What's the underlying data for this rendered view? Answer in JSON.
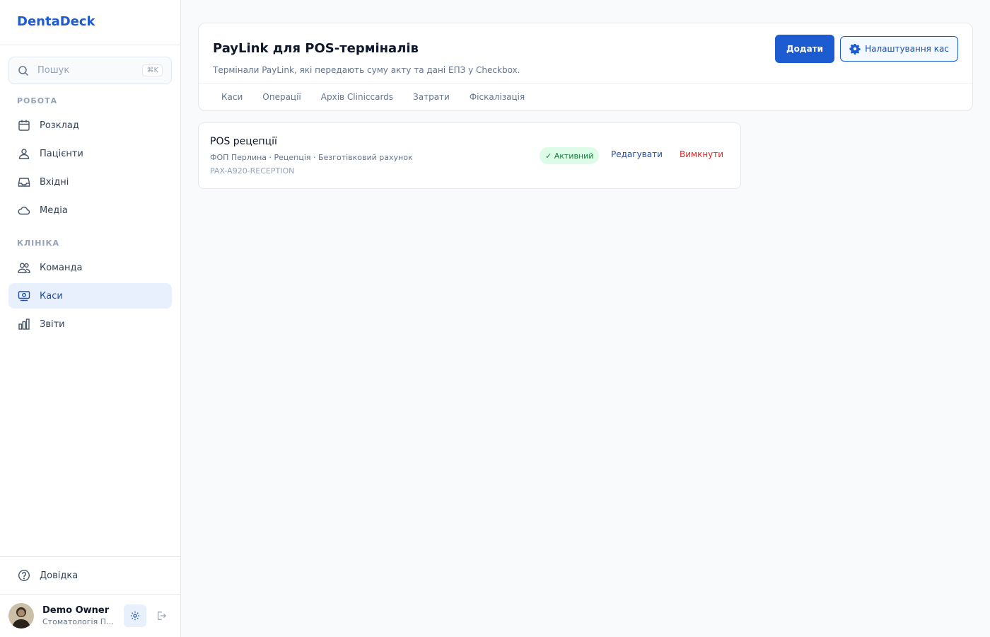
{
  "app": {
    "brand": "DentaDeck"
  },
  "search": {
    "placeholder": "Пошук",
    "shortcut": "⌘K"
  },
  "sidebar": {
    "sections": [
      {
        "label": "РОБОТА"
      },
      {
        "label": "КЛІНІКА"
      }
    ],
    "items": [
      {
        "label": "Розклад",
        "icon": "calendar-icon"
      },
      {
        "label": "Пацієнти",
        "icon": "patients-icon"
      },
      {
        "label": "Вхідні",
        "icon": "inbox-icon"
      },
      {
        "label": "Медіа",
        "icon": "cloud-icon"
      },
      {
        "label": "Команда",
        "icon": "team-icon"
      },
      {
        "label": "Каси",
        "icon": "cash-register-icon",
        "active": true
      },
      {
        "label": "Звіти",
        "icon": "reports-icon"
      }
    ],
    "help": {
      "label": "Довідка",
      "icon": "help-icon"
    }
  },
  "user": {
    "name": "Demo Owner",
    "org": "Стоматологія Перлина"
  },
  "page": {
    "title": "PayLink для POS-терміналів",
    "subtitle": "Термінали PayLink, які передають суму акту та дані ЕПЗ у Checkbox.",
    "add_label": "Додати",
    "settings_label": "Налаштування кас",
    "tabs": [
      {
        "label": "Каси"
      },
      {
        "label": "Операції"
      },
      {
        "label": "Архів Cliniccards"
      },
      {
        "label": "Затрати"
      },
      {
        "label": "Фіскалізація"
      }
    ]
  },
  "terminals": [
    {
      "name": "POS рецепції",
      "meta": "ФОП Перлина · Рецепція · Безготівковий рахунок",
      "serial": "PAX-A920-RECEPTION",
      "status": "✓ Активний",
      "edit_label": "Редагувати",
      "disable_label": "Вимкнути"
    }
  ],
  "colors": {
    "accent": "#1d5bd0",
    "active_bg": "#e8f0fd",
    "success_bg": "#dcfce7",
    "success_text": "#15803d",
    "danger": "#dc2626"
  }
}
